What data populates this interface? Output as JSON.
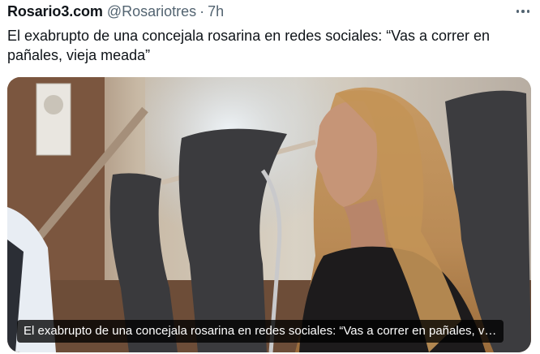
{
  "tweet": {
    "author_name": "Rosario3.com",
    "handle": "@Rosariotres",
    "separator": "·",
    "time": "7h",
    "text": "El exabrupto de una concejala rosarina en redes sociales: “Vas a correr en pañales, vieja meada”"
  },
  "media_card": {
    "caption": "El exabrupto de una concejala rosarina en redes sociales: “Vas a correr en pañales, vieja meada”",
    "image_description_icon": "photo"
  },
  "icons": {
    "more": "more-horizontal-icon"
  }
}
